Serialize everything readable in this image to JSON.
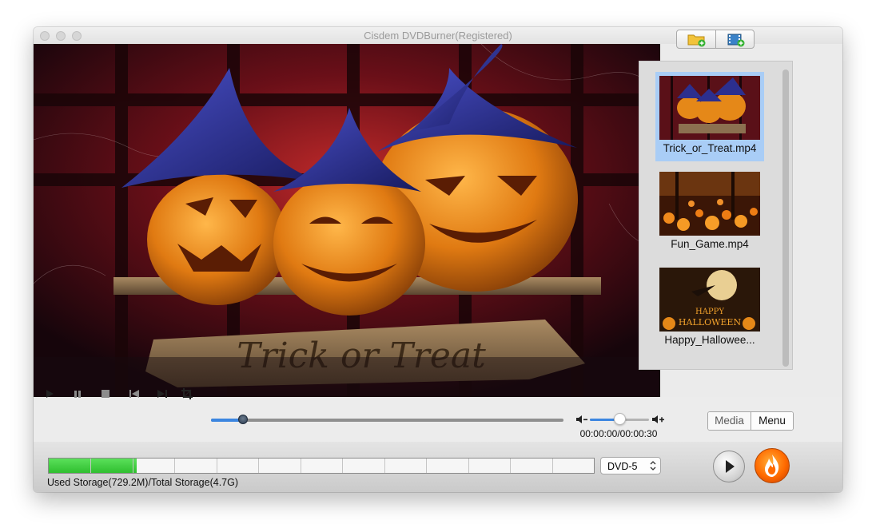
{
  "window": {
    "title": "Cisdem DVDBurner(Registered)"
  },
  "preview": {
    "sign_text": "Trick or Treat"
  },
  "media_toolbar": {
    "add_folder_icon": "folder-add-icon",
    "add_video_icon": "film-add-icon"
  },
  "media_list": {
    "items": [
      {
        "label": "Trick_or_Treat.mp4",
        "selected": true
      },
      {
        "label": "Fun_Game.mp4",
        "selected": false
      },
      {
        "label": "Happy_Hallowee...",
        "selected": false
      }
    ],
    "happy_text": "HAPPY",
    "halloween_text": "HALLOWEEN"
  },
  "player": {
    "icons": [
      "play-icon",
      "pause-icon",
      "stop-icon",
      "previous-icon",
      "next-icon",
      "crop-icon"
    ],
    "progress": 0.09,
    "volume": 0.5,
    "time": "00:00:00/00:00:30"
  },
  "view_toggle": {
    "media_label": "Media",
    "menu_label": "Menu",
    "active": "Menu"
  },
  "storage": {
    "used_fraction": 0.162,
    "segments": 13,
    "text": "Used Storage(729.2M)/Total Storage(4.7G)",
    "disc_type": "DVD-5",
    "fill_color": "#2fbf2f"
  },
  "actions": {
    "preview_icon": "play-icon",
    "burn_icon": "flame-icon",
    "burn_color": "#ff6a00"
  }
}
